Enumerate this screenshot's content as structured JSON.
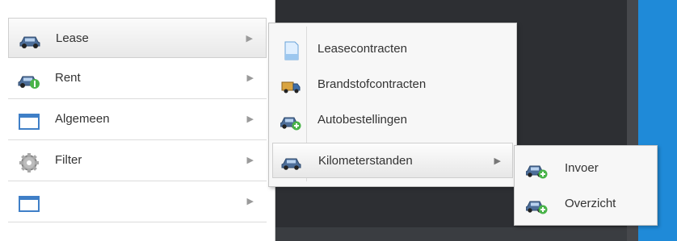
{
  "menu": {
    "items": [
      {
        "label": "Lease",
        "icon": "car-icon"
      },
      {
        "label": "Rent",
        "icon": "car-rent-icon"
      },
      {
        "label": "Algemeen",
        "icon": "window-icon"
      },
      {
        "label": "Filter",
        "icon": "gear-icon"
      },
      {
        "label": "",
        "icon": "window-icon"
      }
    ],
    "submenu_lease": [
      {
        "label": "Leasecontracten",
        "icon": "document-icon"
      },
      {
        "label": "Brandstofcontracten",
        "icon": "fuel-truck-icon"
      },
      {
        "label": "Autobestellingen",
        "icon": "car-add-icon"
      },
      {
        "label": "Kilometerstanden",
        "icon": "car-icon"
      }
    ],
    "submenu_kilometerstanden": [
      {
        "label": "Invoer",
        "icon": "car-add-icon"
      },
      {
        "label": "Overzicht",
        "icon": "car-add-icon"
      }
    ],
    "arrow": "▶"
  },
  "colors": {
    "accent_blue": "#1f8ad8",
    "background_dark": "#2d2f33"
  }
}
